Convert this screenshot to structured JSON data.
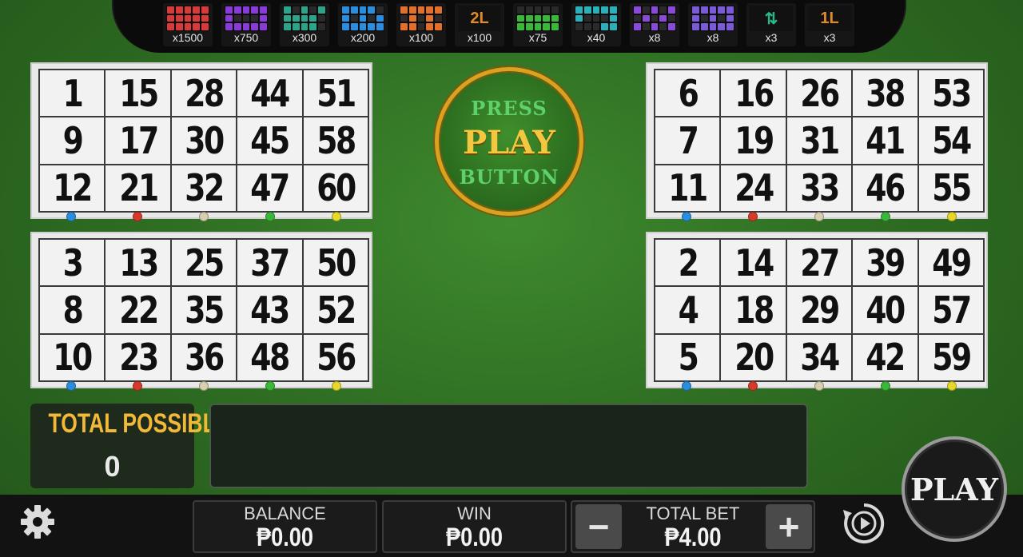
{
  "paytable": [
    {
      "icon": "pattern-full-card-icon",
      "color": "#d83a3a",
      "pattern": "111111111111111",
      "multiplier": "x1500"
    },
    {
      "icon": "pattern-frame-icon",
      "color": "#8a3ad8",
      "pattern": "111111000111111",
      "multiplier": "x750"
    },
    {
      "icon": "pattern-teal-icon",
      "color": "#2aa58a",
      "pattern": "101011111011110",
      "multiplier": "x300"
    },
    {
      "icon": "pattern-blue-icon",
      "color": "#2a8ee0",
      "pattern": "111101010111111",
      "multiplier": "x200"
    },
    {
      "icon": "pattern-orange-icon",
      "color": "#e0702a",
      "pattern": "111110101011011",
      "multiplier": "x100"
    },
    {
      "icon": "two-lines-icon",
      "color": "#e08a2a",
      "label": "2L",
      "multiplier": "x100"
    },
    {
      "icon": "pattern-green-icon",
      "color": "#3ab83a",
      "pattern": "000001111111111",
      "multiplier": "x75"
    },
    {
      "icon": "pattern-cyan-icon",
      "color": "#2ab0b8",
      "pattern": "111111000100011",
      "multiplier": "x40"
    },
    {
      "icon": "pattern-purple-icon",
      "color": "#8a4ad8",
      "pattern": "101010101010101",
      "multiplier": "x8"
    },
    {
      "icon": "pattern-violet-icon",
      "color": "#7a5ad8",
      "pattern": "111111010111111",
      "multiplier": "x8"
    },
    {
      "icon": "arrows-icon",
      "color": "#2ab88a",
      "label": "⇅",
      "multiplier": "x3"
    },
    {
      "icon": "one-line-icon",
      "color": "#e08a2a",
      "label": "1L",
      "multiplier": "x3"
    }
  ],
  "cards": [
    {
      "rows": [
        [
          "1",
          "15",
          "28",
          "44",
          "51"
        ],
        [
          "9",
          "17",
          "30",
          "45",
          "58"
        ],
        [
          "12",
          "21",
          "32",
          "47",
          "60"
        ]
      ]
    },
    {
      "rows": [
        [
          "6",
          "16",
          "26",
          "38",
          "53"
        ],
        [
          "7",
          "19",
          "31",
          "41",
          "54"
        ],
        [
          "11",
          "24",
          "33",
          "46",
          "55"
        ]
      ]
    },
    {
      "rows": [
        [
          "3",
          "13",
          "25",
          "37",
          "50"
        ],
        [
          "8",
          "22",
          "35",
          "43",
          "52"
        ],
        [
          "10",
          "23",
          "36",
          "48",
          "56"
        ]
      ]
    },
    {
      "rows": [
        [
          "2",
          "14",
          "27",
          "39",
          "49"
        ],
        [
          "4",
          "18",
          "29",
          "40",
          "57"
        ],
        [
          "5",
          "20",
          "34",
          "42",
          "59"
        ]
      ]
    }
  ],
  "dot_colors": [
    "#2a8ee0",
    "#d83a2a",
    "#d8cfb0",
    "#3ab83a",
    "#e8d82a"
  ],
  "press_play": {
    "line1": "PRESS",
    "line2": "PLAY",
    "line3": "BUTTON"
  },
  "total_possible": {
    "label": "TOTAL POSSIBLE",
    "value": "0"
  },
  "balance": {
    "label": "BALANCE",
    "value": "₱0.00"
  },
  "win": {
    "label": "WIN",
    "value": "₱0.00"
  },
  "total_bet": {
    "label": "TOTAL BET",
    "value": "₱4.00",
    "minus": "−",
    "plus": "+"
  },
  "play_button": "PLAY"
}
